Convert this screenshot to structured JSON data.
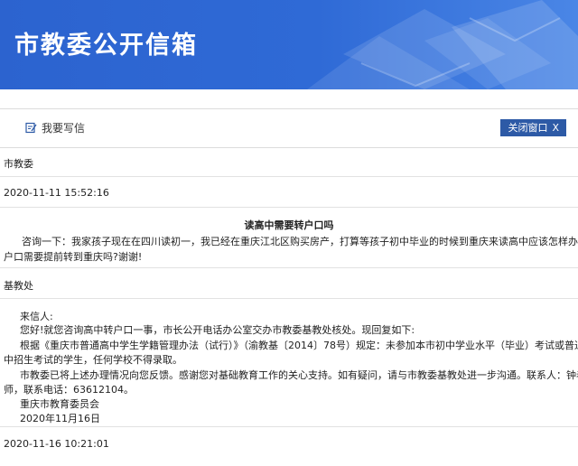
{
  "banner": {
    "title": "市教委公开信箱"
  },
  "toolbar": {
    "write_label": "我要写信",
    "close_label": "关闭窗口",
    "close_mark": "X"
  },
  "letter": {
    "recipient": "市教委",
    "date": "2020-11-11 15:52:16",
    "title": "读高中需要转户口吗",
    "body_line1": "咨询一下：我家孩子现在在四川读初一，我已经在重庆江北区购买房产，打算等孩子初中毕业的时候到重庆来读高中应该怎样办理？",
    "body_line2": "户口需要提前转到重庆吗?谢谢!"
  },
  "reply": {
    "office": "基教处",
    "greeting": "来信人:",
    "line1": "您好!就您咨询高中转户口一事，市长公开电话办公室交办市教委基教处核处。现回复如下:",
    "line2": "根据《重庆市普通高中学生学籍管理办法（试行）》（渝教基〔2014〕78号）规定：未参加本市初中学业水平（毕业）考试或普通高",
    "line3": "中招生考试的学生，任何学校不得录取。",
    "line4": "市教委已将上述办理情况向您反馈。感谢您对基础教育工作的关心支持。如有疑问，请与市教委基教处进一步沟通。联系人：钟老",
    "line5": "师，联系电话：63612104。",
    "signer": "重庆市教育委员会",
    "sign_date": "2020年11月16日"
  },
  "next_date": "2020-11-16 10:21:01",
  "colors": {
    "banner": "#2f6ad6",
    "button": "#2d5aa6",
    "divider": "#e2e2e2"
  }
}
